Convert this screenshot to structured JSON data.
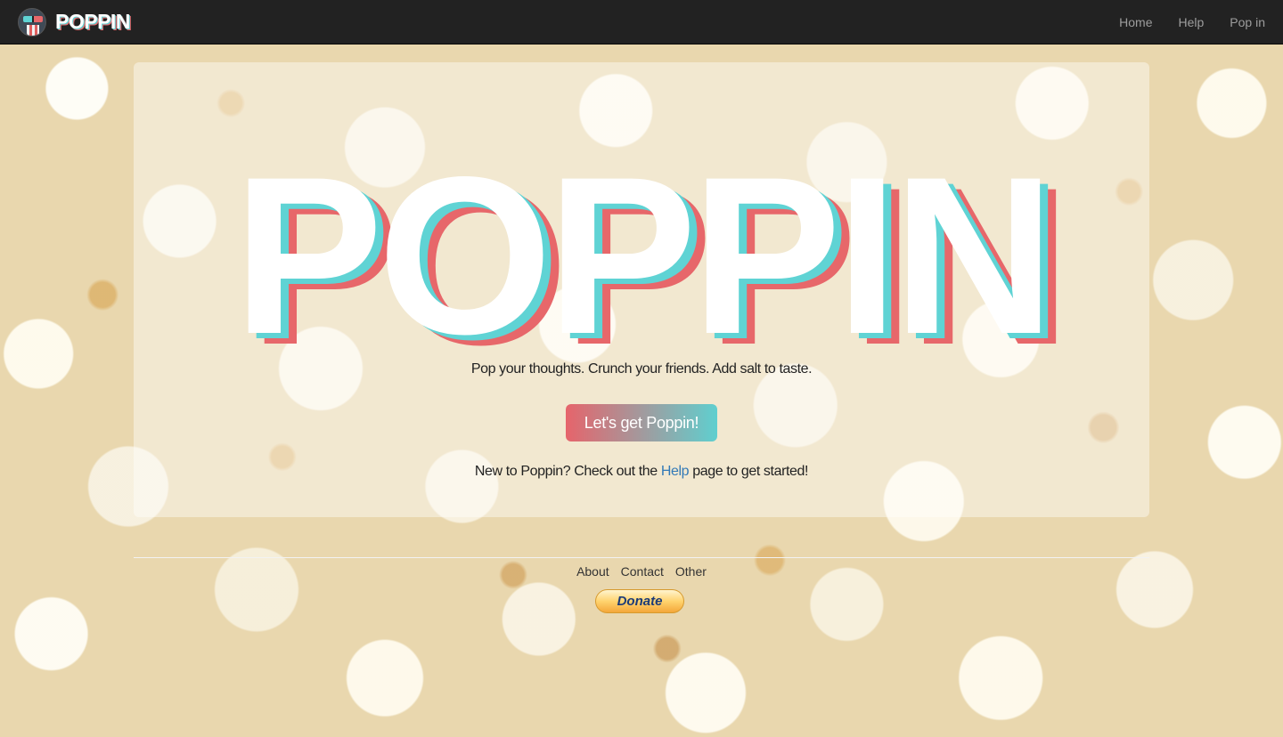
{
  "navbar": {
    "brand": "POPPIN",
    "links": [
      "Home",
      "Help",
      "Pop in"
    ]
  },
  "hero": {
    "title": "POPPIN",
    "tagline": "Pop your thoughts. Crunch your friends. Add salt to taste.",
    "cta_label": "Let's get Poppin!",
    "intro_before": "New to Poppin? Check out the",
    "intro_link": "Help",
    "intro_after": "page to get started!"
  },
  "footer": {
    "links": [
      "About",
      "Contact",
      "Other"
    ],
    "donate_label": "Donate"
  },
  "colors": {
    "navbar": "#222222",
    "shadow_teal": "#5fd3d4",
    "shadow_red": "#e7676a",
    "link_blue": "#337ab7"
  }
}
